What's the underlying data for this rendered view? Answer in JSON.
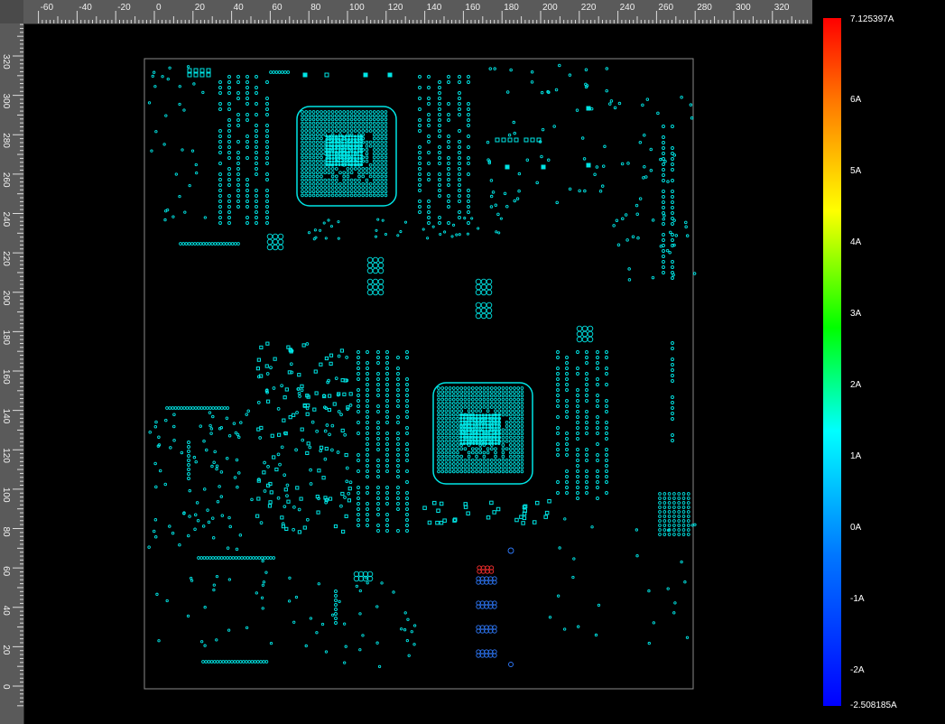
{
  "ruler_top": {
    "labels": [
      "-60",
      "-40",
      "-20",
      "0",
      "20",
      "40",
      "60",
      "80",
      "100",
      "120",
      "140",
      "160",
      "180",
      "200",
      "220",
      "240",
      "260",
      "280",
      "300",
      "320"
    ]
  },
  "ruler_left": {
    "labels": [
      "320",
      "300",
      "280",
      "260",
      "240",
      "220",
      "200",
      "180",
      "160",
      "140",
      "120",
      "100",
      "80",
      "60",
      "40",
      "20",
      "0"
    ]
  },
  "legend": {
    "max_label": "7.125397A",
    "labels": [
      "6A",
      "5A",
      "4A",
      "3A",
      "2A",
      "1A",
      "0A",
      "-1A",
      "-2A"
    ],
    "min_label": "-2.508185A",
    "colors": {
      "max": "#ff0000",
      "zero": "#00ffff",
      "min": "#0000ff"
    }
  },
  "board": {
    "trace_color": "#00e5e5",
    "outline_color": "#8a8a8a",
    "hot_color": "#ff3030",
    "cold_color": "#2f7bff"
  }
}
